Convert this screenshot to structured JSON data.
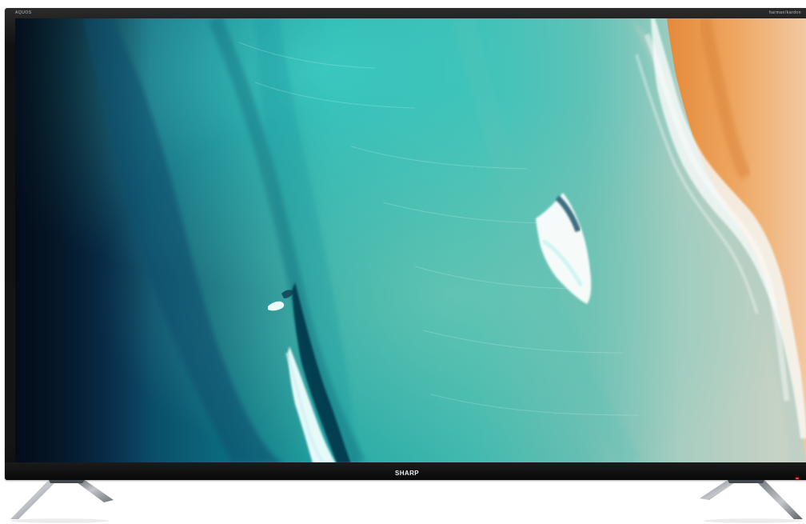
{
  "tv": {
    "brand": "SHARP",
    "corner_left": "AQUOS",
    "corner_right": "harman/kardon"
  },
  "screen": {
    "scene": "aerial-ocean-beach-surf"
  },
  "colors": {
    "bezel": "#121212",
    "deep_ocean": "#0b2f4a",
    "teal_water": "#22a4a4",
    "surf": "#f2fbfb",
    "sand": "#e5a55d",
    "stand_metal": "#8f959b",
    "power_led": "#ff3b3b"
  }
}
